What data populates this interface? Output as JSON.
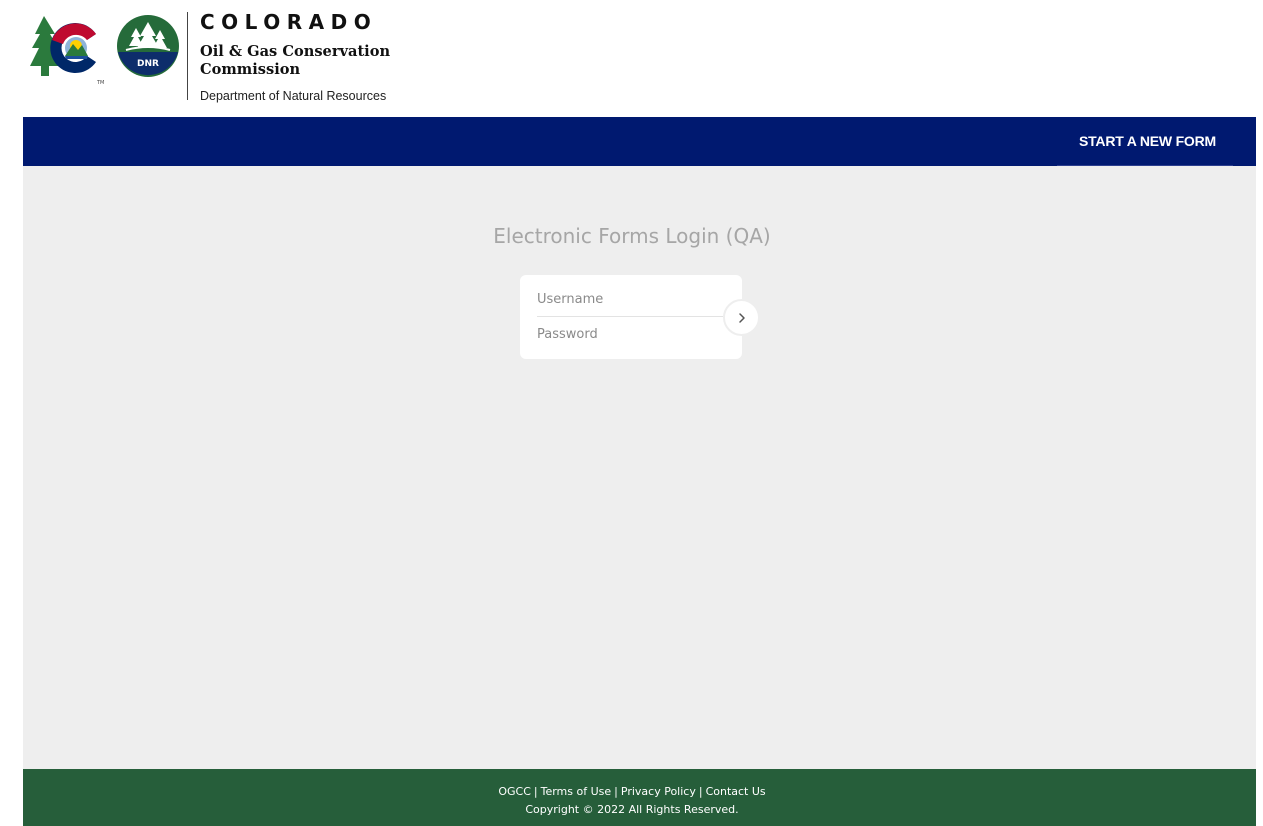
{
  "header": {
    "agency_word": "COLORADO",
    "commission_line1": "Oil & Gas Conservation",
    "commission_line2": "Commission",
    "department": "Department of Natural Resources",
    "tm_mark": "TM",
    "seal_text": "DNR"
  },
  "nav": {
    "start_form_label": "START A NEW FORM"
  },
  "login": {
    "title": "Electronic Forms Login (QA)",
    "username_placeholder": "Username",
    "password_placeholder": "Password",
    "submit_icon": "chevron-right-icon"
  },
  "footer": {
    "links": [
      "OGCC",
      "Terms of Use",
      "Privacy Policy",
      "Contact Us"
    ],
    "separator": "|",
    "copyright": "Copyright © 2022 All Rights Reserved."
  },
  "colors": {
    "nav_bg": "#001970",
    "main_bg": "#eeeeee",
    "footer_bg": "#265e3a",
    "title_text": "#a6a6a6"
  }
}
